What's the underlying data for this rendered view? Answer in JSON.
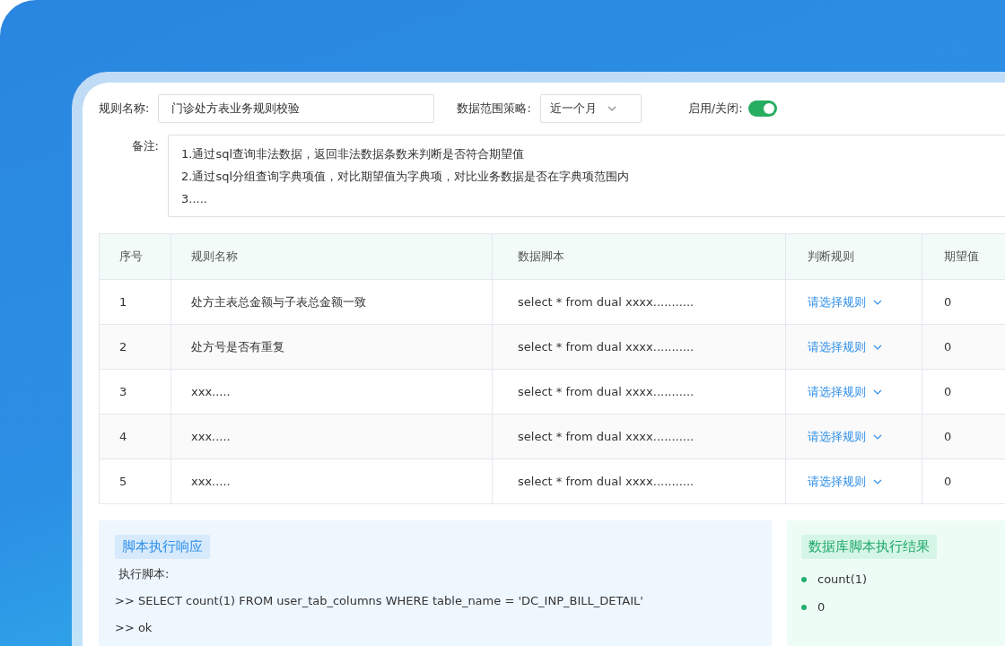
{
  "form": {
    "rule_name": {
      "label": "规则名称:",
      "value": "门诊处方表业务规则校验"
    },
    "data_range": {
      "label": "数据范围策略:",
      "value": "近一个月"
    },
    "toggle": {
      "label": "启用/关闭:",
      "on": true
    },
    "remarks": {
      "label": "备注:",
      "lines": [
        "1.通过sql查询非法数据，返回非法数据条数来判断是否符合期望值",
        "2.通过sql分组查询字典项值，对比期望值为字典项，对比业务数据是否在字典项范围内",
        "3....."
      ]
    }
  },
  "table": {
    "columns": [
      "序号",
      "规则名称",
      "数据脚本",
      "判断规则",
      "期望值"
    ],
    "rows": [
      {
        "index": "1",
        "name": "处方主表总金额与子表总金额一致",
        "script": "select * from dual xxxx...........",
        "rule": "请选择规则",
        "expected": "0"
      },
      {
        "index": "2",
        "name": "处方号是否有重复",
        "script": "select * from dual xxxx...........",
        "rule": "请选择规则",
        "expected": "0"
      },
      {
        "index": "3",
        "name": "xxx.....",
        "script": "select * from dual xxxx...........",
        "rule": "请选择规则",
        "expected": "0"
      },
      {
        "index": "4",
        "name": "xxx.....",
        "script": "select * from dual xxxx...........",
        "rule": "请选择规则",
        "expected": "0"
      },
      {
        "index": "5",
        "name": "xxx.....",
        "script": "select * from dual xxxx...........",
        "rule": "请选择规则",
        "expected": "0"
      }
    ]
  },
  "response_panel": {
    "title": "脚本执行响应",
    "lines": [
      "执行脚本:",
      ">> SELECT count(1) FROM user_tab_columns WHERE  table_name = 'DC_INP_BILL_DETAIL'",
      ">> ok"
    ]
  },
  "result_panel": {
    "title": "数据库脚本执行结果",
    "items": [
      "count(1)",
      "0"
    ]
  }
}
